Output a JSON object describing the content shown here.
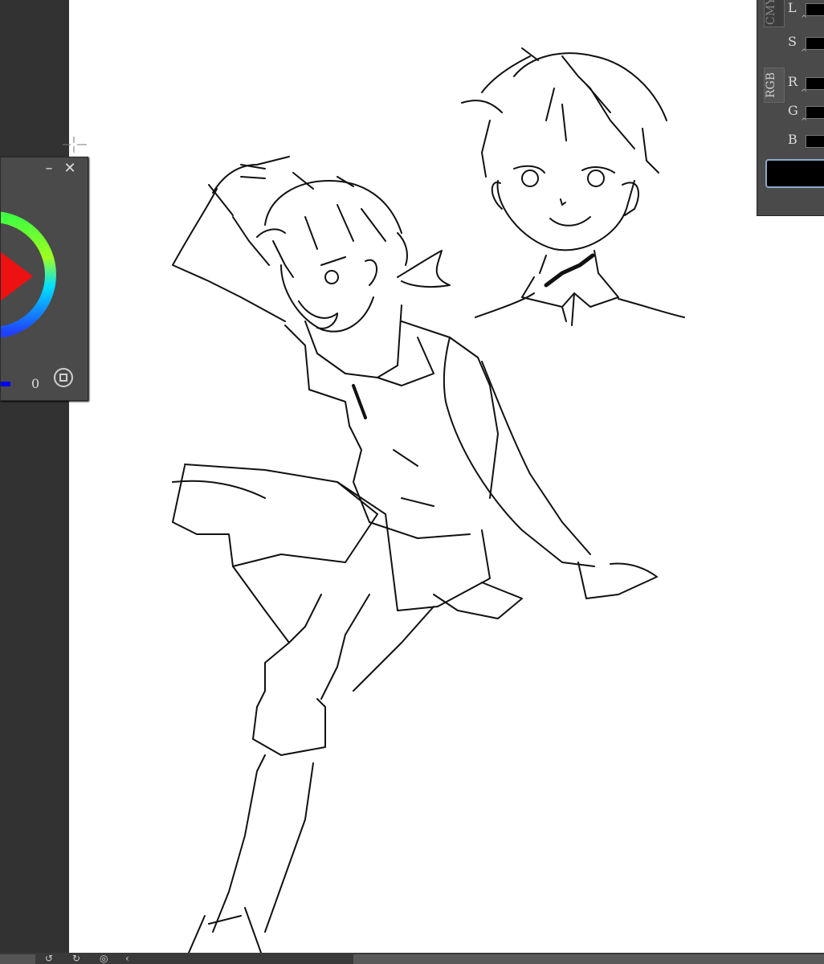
{
  "colors": {
    "canvas_bg": "#ffffff",
    "workspace_bg": "#323232",
    "panel_bg": "#4a4a4a",
    "selected_color": "#000000",
    "selection_outline": "#8fa8c8"
  },
  "color_wheel_panel": {
    "minimize_icon": "minimize-icon",
    "close_icon": "close-icon",
    "value": "0",
    "mode_icon": "circle-square-icon"
  },
  "color_slider_panel": {
    "tabs": [
      "CMY",
      "RGB"
    ],
    "sliders": [
      {
        "label": "L"
      },
      {
        "label": "S"
      },
      {
        "label": "R"
      },
      {
        "label": "G"
      },
      {
        "label": "B"
      }
    ]
  },
  "bottom_toolbar": {
    "tools": [
      "rotate-left-icon",
      "rotate-right-icon",
      "compass-icon",
      "chevron-left-icon"
    ]
  }
}
